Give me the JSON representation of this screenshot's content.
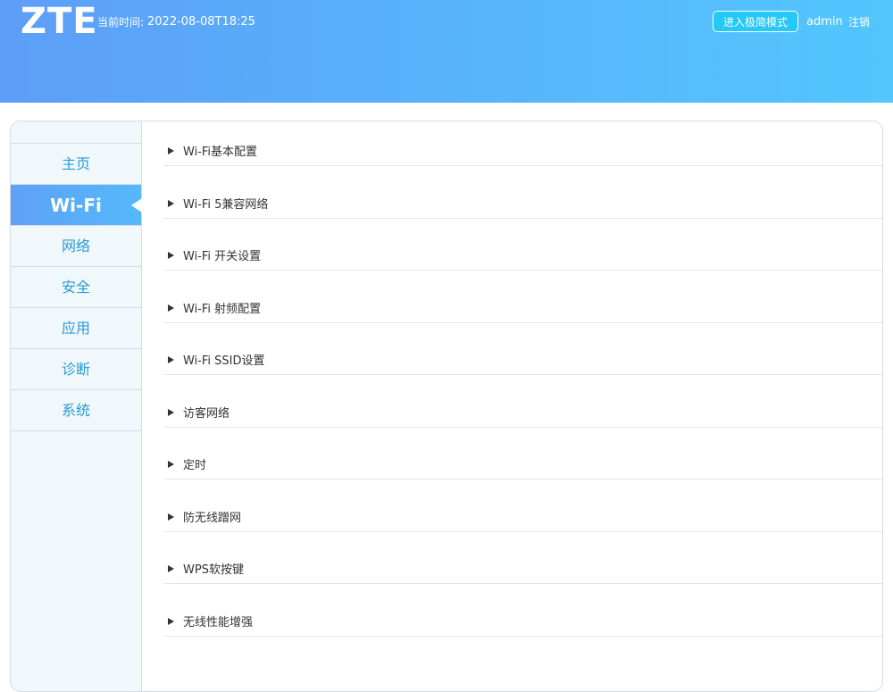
{
  "header": {
    "logo": "ZTE",
    "time_label": "当前时间:",
    "time_value": "2022-08-08T18:25",
    "simple_mode_button": "进入极简模式",
    "user": "admin",
    "logout": "注销"
  },
  "sidebar": {
    "items": [
      {
        "label": "主页",
        "active": false
      },
      {
        "label": "Wi-Fi",
        "active": true
      },
      {
        "label": "网络",
        "active": false
      },
      {
        "label": "安全",
        "active": false
      },
      {
        "label": "应用",
        "active": false
      },
      {
        "label": "诊断",
        "active": false
      },
      {
        "label": "系统",
        "active": false
      }
    ]
  },
  "sections": [
    {
      "label": "Wi-Fi基本配置",
      "icon": "triangle-right-icon"
    },
    {
      "label": "Wi-Fi 5兼容网络",
      "icon": "triangle-right-icon"
    },
    {
      "label": "Wi-Fi 开关设置",
      "icon": "triangle-right-icon"
    },
    {
      "label": "Wi-Fi 射频配置",
      "icon": "triangle-right-icon"
    },
    {
      "label": "Wi-Fi SSID设置",
      "icon": "triangle-right-icon"
    },
    {
      "label": "访客网络",
      "icon": "triangle-right-icon"
    },
    {
      "label": "定时",
      "icon": "triangle-right-icon"
    },
    {
      "label": "防无线蹭网",
      "icon": "triangle-right-icon"
    },
    {
      "label": "WPS软按键",
      "icon": "triangle-right-icon"
    },
    {
      "label": "无线性能增强",
      "icon": "triangle-right-icon"
    }
  ],
  "colors": {
    "header_gradient_start": "#5d9ef8",
    "header_gradient_end": "#52c6fd",
    "sidebar_text": "#2b9bd2",
    "sidebar_bg": "#f0f8fc",
    "button_bg": "#25c8f7"
  }
}
